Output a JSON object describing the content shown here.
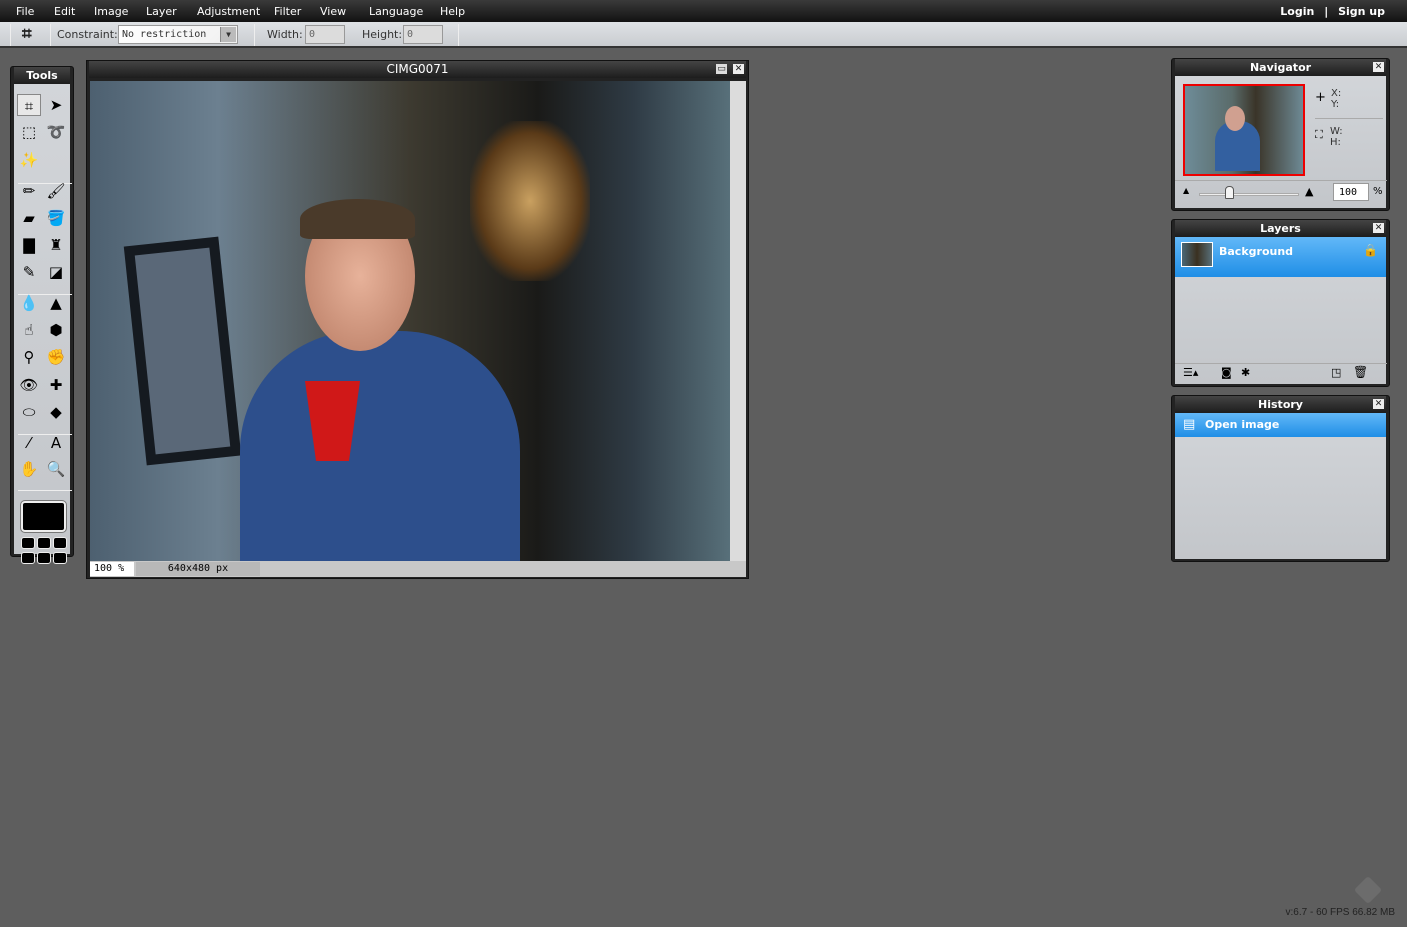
{
  "menu": [
    "File",
    "Edit",
    "Image",
    "Layer",
    "Adjustment",
    "Filter",
    "View",
    "Language",
    "Help"
  ],
  "account": {
    "login": "Login",
    "sep": "|",
    "signup": "Sign up"
  },
  "toolbar": {
    "constraint_label": "Constraint:",
    "constraint_value": "No restriction",
    "width_label": "Width:",
    "width_value": "0",
    "height_label": "Height:",
    "height_value": "0"
  },
  "tools": {
    "title": "Tools",
    "items": [
      [
        "crop-icon",
        "⌗"
      ],
      [
        "move-icon",
        "➤"
      ],
      [
        "marquee-icon",
        "⬚"
      ],
      [
        "lasso-icon",
        "➰"
      ],
      [
        "magic-wand-icon",
        "✨"
      ],
      [
        "pencil-icon",
        "✏"
      ],
      [
        "brush-icon",
        "🖌"
      ],
      [
        "eraser-icon",
        "▰"
      ],
      [
        "paint-bucket-icon",
        "🪣"
      ],
      [
        "gradient-icon",
        "▇"
      ],
      [
        "clone-stamp-icon",
        "♜"
      ],
      [
        "color-replace-icon",
        "✎"
      ],
      [
        "drawing-shapes-icon",
        "◪"
      ],
      [
        "blur-icon",
        "💧"
      ],
      [
        "sharpen-icon",
        "▲"
      ],
      [
        "smudge-icon",
        "☝"
      ],
      [
        "sponge-icon",
        "⬢"
      ],
      [
        "dodge-icon",
        "⚲"
      ],
      [
        "burn-icon",
        "✊"
      ],
      [
        "red-eye-icon",
        "👁"
      ],
      [
        "spot-heal-icon",
        "✚"
      ],
      [
        "bloat-icon",
        "⬭"
      ],
      [
        "pinch-icon",
        "◆"
      ],
      [
        "color-picker-icon",
        "⁄"
      ],
      [
        "type-icon",
        "A"
      ],
      [
        "hand-icon",
        "✋"
      ],
      [
        "zoom-icon",
        "🔍"
      ]
    ],
    "primary_color": "#000000",
    "secondary_color": "#000000"
  },
  "image_window": {
    "title": "CIMG0071",
    "zoom": "100",
    "zoom_unit": "%",
    "size": "640x480 px"
  },
  "navigator": {
    "title": "Navigator",
    "x": "X:",
    "y": "Y:",
    "w": "W:",
    "h": "H:",
    "zoom": "100",
    "unit": "%",
    "slider": 0.3
  },
  "layers": {
    "title": "Layers",
    "items": [
      {
        "name": "Background",
        "locked": true
      }
    ]
  },
  "history": {
    "title": "History",
    "items": [
      "Open image"
    ]
  },
  "footer": {
    "version": "v:6.7 - 60 FPS 66.82 MB"
  },
  "colors": {
    "selection": "#3aa0f0",
    "accent_border": "#ff0000"
  }
}
